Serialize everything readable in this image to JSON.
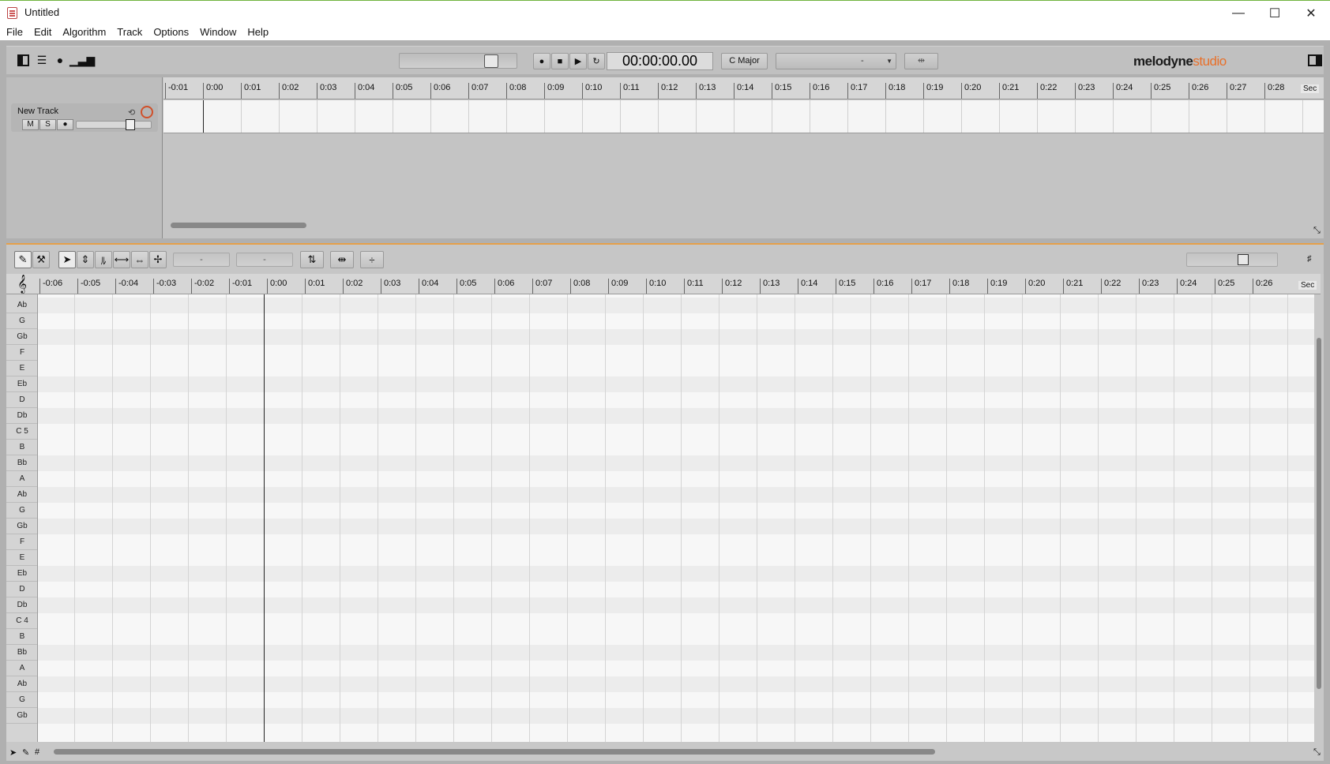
{
  "window": {
    "title": "Untitled",
    "controls": {
      "minimize": "—",
      "maximize": "☐",
      "close": "✕"
    }
  },
  "menu": [
    "File",
    "Edit",
    "Algorithm",
    "Track",
    "Options",
    "Window",
    "Help"
  ],
  "toolbar": {
    "time": "00:00:00.00",
    "key": "C Major",
    "tempo_value": "-",
    "logo_brand": "melodyne",
    "logo_edition": "studio",
    "transport": [
      "●",
      "■",
      "▶",
      "↻"
    ]
  },
  "arrangement": {
    "ruler": [
      "-0:01",
      "0:00",
      "0:01",
      "0:02",
      "0:03",
      "0:04",
      "0:05",
      "0:06",
      "0:07",
      "0:08",
      "0:09",
      "0:10",
      "0:11",
      "0:12",
      "0:13",
      "0:14",
      "0:15",
      "0:16",
      "0:17",
      "0:18",
      "0:19",
      "0:20",
      "0:21",
      "0:22",
      "0:23",
      "0:24",
      "0:25",
      "0:26",
      "0:27",
      "0:28"
    ],
    "ruler_unit": "Sec",
    "track": {
      "name": "New Track",
      "mute": "M",
      "solo": "S"
    }
  },
  "editor": {
    "field1": "-",
    "field2": "-",
    "ruler": [
      "-0:06",
      "-0:05",
      "-0:04",
      "-0:03",
      "-0:02",
      "-0:01",
      "0:00",
      "0:01",
      "0:02",
      "0:03",
      "0:04",
      "0:05",
      "0:06",
      "0:07",
      "0:08",
      "0:09",
      "0:10",
      "0:11",
      "0:12",
      "0:13",
      "0:14",
      "0:15",
      "0:16",
      "0:17",
      "0:18",
      "0:19",
      "0:20",
      "0:21",
      "0:22",
      "0:23",
      "0:24",
      "0:25",
      "0:26"
    ],
    "ruler_unit": "Sec",
    "pitches": [
      "Ab",
      "G",
      "Gb",
      "F",
      "E",
      "Eb",
      "D",
      "Db",
      "C 5",
      "B",
      "Bb",
      "A",
      "Ab",
      "G",
      "Gb",
      "F",
      "E",
      "Eb",
      "D",
      "Db",
      "C 4",
      "B",
      "Bb",
      "A",
      "Ab",
      "G",
      "Gb"
    ],
    "clef": "𝄞"
  }
}
